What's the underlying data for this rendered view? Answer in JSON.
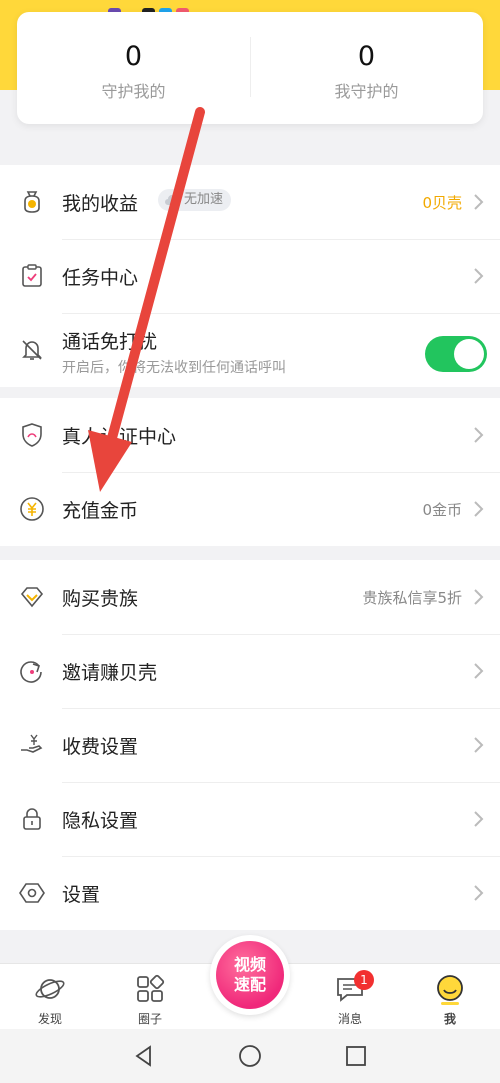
{
  "guard": {
    "left": {
      "count": "0",
      "label": "守护我的"
    },
    "right": {
      "count": "0",
      "label": "我守护的"
    }
  },
  "earnings": {
    "label": "我的收益",
    "badge": "无加速",
    "value": "0贝壳",
    "value_color": "#f2a900"
  },
  "tasks": {
    "label": "任务中心"
  },
  "dnd": {
    "label": "通话免打扰",
    "desc": "开启后，你将无法收到任何通话呼叫",
    "enabled": true
  },
  "verify": {
    "label": "真人认证中心"
  },
  "recharge": {
    "label": "充值金币",
    "value": "0金币"
  },
  "noble": {
    "label": "购买贵族",
    "value": "贵族私信享5折"
  },
  "invite": {
    "label": "邀请赚贝壳"
  },
  "fee": {
    "label": "收费设置"
  },
  "privacy": {
    "label": "隐私设置"
  },
  "settings": {
    "label": "设置"
  },
  "tabs": {
    "discover": "发现",
    "circle": "圈子",
    "match_line1": "视频",
    "match_line2": "速配",
    "messages": "消息",
    "messages_badge": "1",
    "me": "我"
  },
  "colors": {
    "accent": "#ffd83a",
    "toggle_on": "#22c55e",
    "arrow": "#e8453c"
  }
}
